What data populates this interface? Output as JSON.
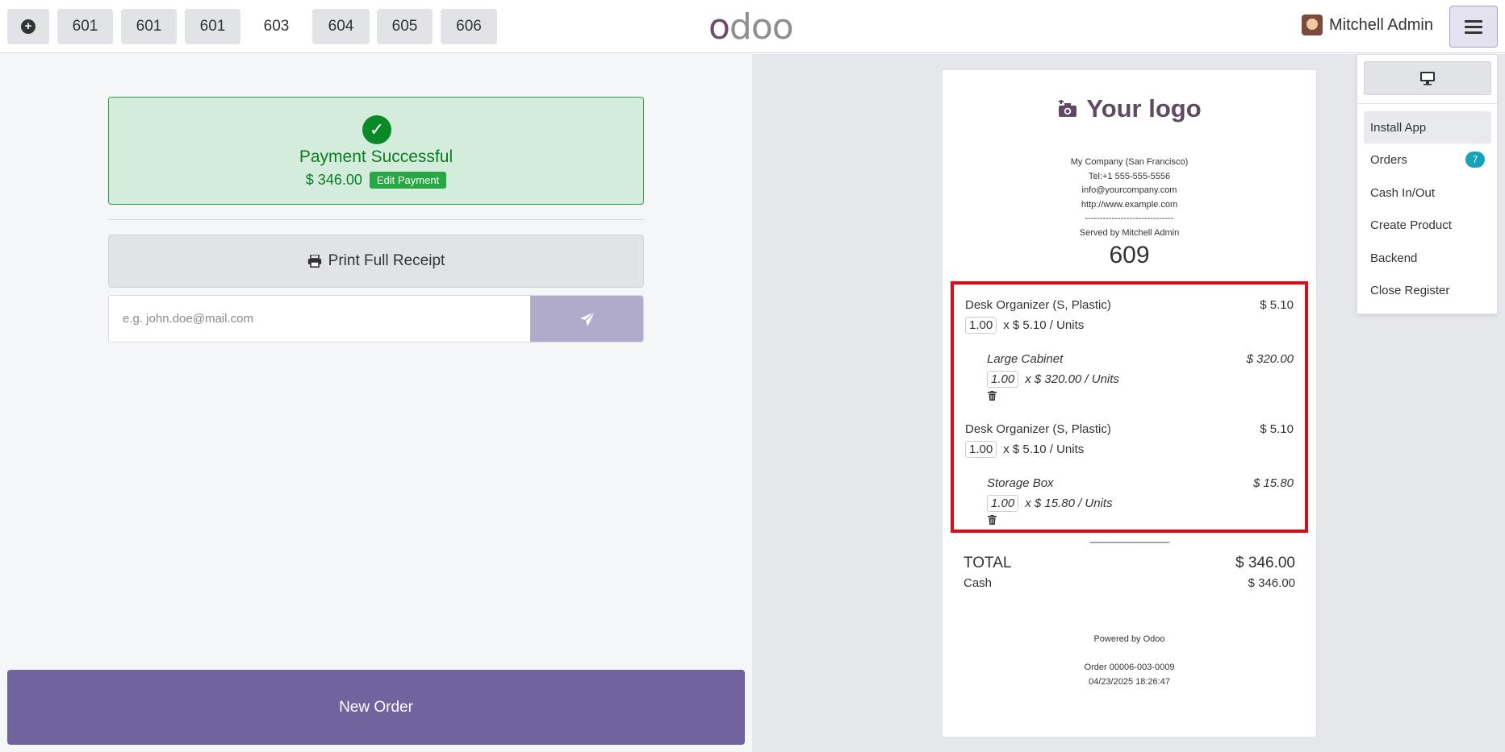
{
  "header": {
    "plus_icon": "plus-circle-icon",
    "order_tabs": [
      {
        "label": "601",
        "active": false
      },
      {
        "label": "601",
        "active": false
      },
      {
        "label": "601",
        "active": false
      },
      {
        "label": "603",
        "active": true
      },
      {
        "label": "604",
        "active": false
      },
      {
        "label": "605",
        "active": false
      },
      {
        "label": "606",
        "active": false
      }
    ],
    "logo_text": "odoo",
    "user_name": "Mitchell Admin",
    "menu_icon": "hamburger-icon"
  },
  "payment": {
    "status": "Payment Successful",
    "amount": "$ 346.00",
    "edit_label": "Edit Payment",
    "print_label": "Print Full Receipt",
    "email_placeholder": "e.g. john.doe@mail.com",
    "send_icon": "paper-plane-icon",
    "new_order_label": "New Order"
  },
  "receipt": {
    "logo_text": "Your logo",
    "company": "My Company (San Francisco)",
    "tel": "Tel:+1 555-555-5556",
    "email": "info@yourcompany.com",
    "website": "http://www.example.com",
    "separator": "------------------------------",
    "served_by": "Served by Mitchell Admin",
    "order_number": "609",
    "lines": [
      {
        "name": "Desk Organizer (S, Plastic)",
        "price": "$ 5.10",
        "qty": "1.00",
        "unit": "x $ 5.10 / Units",
        "combo": false
      },
      {
        "name": "Large Cabinet",
        "price": "$ 320.00",
        "qty": "1.00",
        "unit": "x $ 320.00 / Units",
        "combo": true
      },
      {
        "name": "Desk Organizer (S, Plastic)",
        "price": "$ 5.10",
        "qty": "1.00",
        "unit": "x $ 5.10 / Units",
        "combo": false
      },
      {
        "name": "Storage Box",
        "price": "$ 15.80",
        "qty": "1.00",
        "unit": "x $ 15.80 / Units",
        "combo": true
      }
    ],
    "dash_line": "-------------------------------------",
    "total_label": "TOTAL",
    "total_value": "$ 346.00",
    "cash_label": "Cash",
    "cash_value": "$ 346.00",
    "powered_by": "Powered by Odoo",
    "order_ref": "Order 00006-003-0009",
    "datetime": "04/23/2025 18:26:47"
  },
  "menu": {
    "screen_icon": "desktop-icon",
    "items": [
      {
        "label": "Install App"
      },
      {
        "label": "Orders",
        "badge": "7"
      },
      {
        "label": "Cash In/Out"
      },
      {
        "label": "Create Product"
      },
      {
        "label": "Backend"
      },
      {
        "label": "Close Register"
      }
    ]
  },
  "colors": {
    "brand": "#714b67",
    "primary_button": "#71639e",
    "success": "#0a7d22",
    "highlight_border": "#e30613",
    "badge": "#17a2b8"
  }
}
